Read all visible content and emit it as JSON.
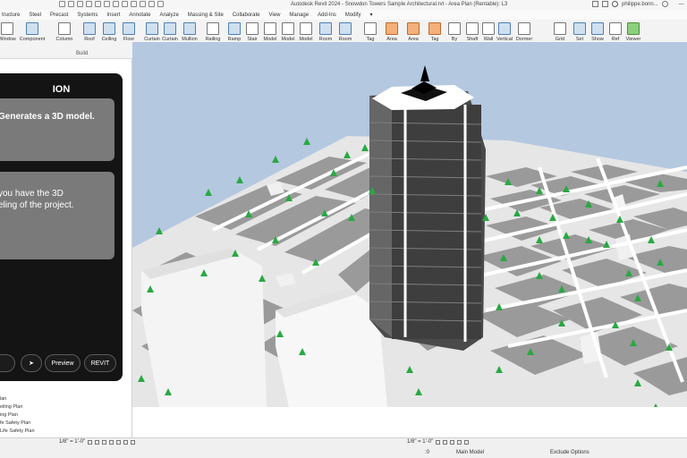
{
  "window": {
    "title": "Autodesk Revit 2024 - Snowdon Towers Sample Architectural.rvt - Area Plan (Rentable): L3",
    "user": "philippe.bonn..."
  },
  "menu": [
    "tructure",
    "Steel",
    "Precast",
    "Systems",
    "Insert",
    "Annotate",
    "Analyze",
    "Massing & Site",
    "Collaborate",
    "View",
    "Manage",
    "Add-Ins",
    "Modify",
    "▾"
  ],
  "ribbon": {
    "group_label": "Build",
    "tools": [
      "Window",
      "Component",
      "Column",
      "Roof",
      "Ceiling",
      "Floor",
      "Curtain",
      "Curtain",
      "Mullion",
      "Railing",
      "Ramp",
      "Stair",
      "Model",
      "Model",
      "Model",
      "Room",
      "Room",
      "Tag",
      "Area",
      "Area",
      "Tag",
      "By",
      "Shaft",
      "Wall",
      "Vertical",
      "Dormer",
      "Grid",
      "Set",
      "Show",
      "Ref",
      "Viewer"
    ]
  },
  "ion": {
    "title": "ION",
    "message1": "Generates a 3D model.",
    "message2_line1": "you have the 3D",
    "message2_line2": "eling of the project.",
    "send_label": "➤",
    "preview_label": "Preview",
    "revit_label": "REVIT"
  },
  "browser": {
    "items": [
      "lan",
      "eiling Plan",
      "ing Plan",
      "fe Safety Plan",
      "Life Safety Plan"
    ]
  },
  "status": {
    "scale_left": "1/8\" = 1'-0\"",
    "scale_right": "1/8\" = 1'-0\"",
    "main_model": "Main Model",
    "exclude_options": "Exclude Options",
    "zero": ":0"
  },
  "colors": {
    "sky": "#b4c8e0",
    "ion_bg": "#141414",
    "bubble": "#7a7a7a",
    "tower": "#4a4a4a",
    "tree": "#2aa843"
  }
}
